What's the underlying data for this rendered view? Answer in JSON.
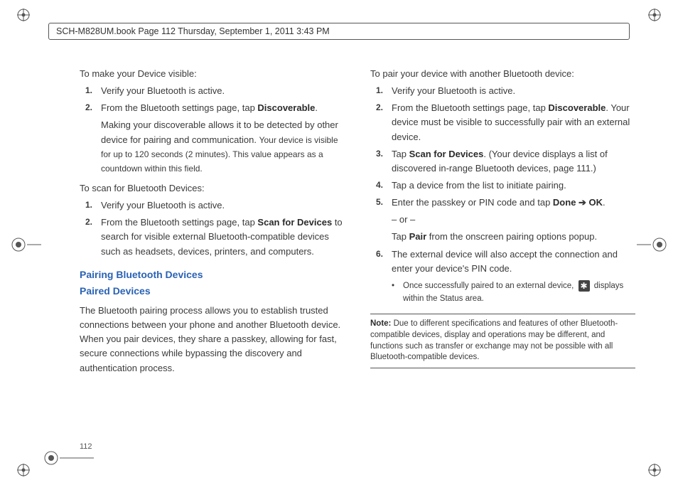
{
  "header": {
    "crop_line": "SCH-M828UM.book  Page 112  Thursday, September 1, 2011  3:43 PM"
  },
  "page_number": "112",
  "left": {
    "intro1": "To make your Device visible:",
    "l1": {
      "n1": "1.",
      "t1": "Verify your Bluetooth is active.",
      "n2": "2.",
      "t2a": "From the Bluetooth settings page, tap ",
      "t2b": "Discoverable",
      "t2c": ".",
      "t2_sub1": "Making your discoverable allows it to be detected by other device for pairing and communication. ",
      "t2_sub2": "Your device is visible for up to 120 seconds (2 minutes). This value appears as a countdown within this field."
    },
    "intro2": "To scan for Bluetooth Devices:",
    "l2": {
      "n1": "1.",
      "t1": "Verify your Bluetooth is active.",
      "n2": "2.",
      "t2a": "From the Bluetooth settings page, tap ",
      "t2b": "Scan for Devices",
      "t2c": " to search for visible external Bluetooth-compatible devices such as headsets, devices, printers, and computers."
    },
    "h1": "Pairing Bluetooth Devices",
    "h2": "Paired Devices",
    "p1": "The Bluetooth pairing process allows you to establish trusted connections between your phone and another Bluetooth device. When you pair devices, they share a passkey, allowing for fast, secure connections while bypassing the discovery and authentication process."
  },
  "right": {
    "intro": "To pair your device with another Bluetooth device:",
    "r": {
      "n1": "1.",
      "t1": "Verify your Bluetooth is active.",
      "n2": "2.",
      "t2a": "From the Bluetooth settings page, tap ",
      "t2b": "Discoverable",
      "t2c": ". Your device must be visible to successfully pair with an external device.",
      "n3": "3.",
      "t3a": "Tap ",
      "t3b": "Scan for Devices",
      "t3c": ". (Your device displays a list of discovered in-range Bluetooth devices, page 111.)",
      "n4": "4.",
      "t4": "Tap a device from the list to initiate pairing.",
      "n5": "5.",
      "t5a": "Enter the passkey or PIN code and tap ",
      "t5b": "Done",
      "t5arrow": " ➔ ",
      "t5c": "OK",
      "t5d": ".",
      "t5_or": "– or –",
      "t5e": "Tap ",
      "t5f": "Pair",
      "t5g": " from the onscreen pairing options popup.",
      "n6": "6.",
      "t6": "The external device will also accept the connection and enter your device's PIN code.",
      "bullet_a": "Once successfully paired to an external device, ",
      "bullet_b": " displays within the Status area."
    },
    "note_label": "Note:",
    "note_body": " Due to different specifications and features of other Bluetooth-compatible devices, display and operations may be different, and functions such as transfer or exchange may not be possible with all Bluetooth-compatible devices."
  }
}
